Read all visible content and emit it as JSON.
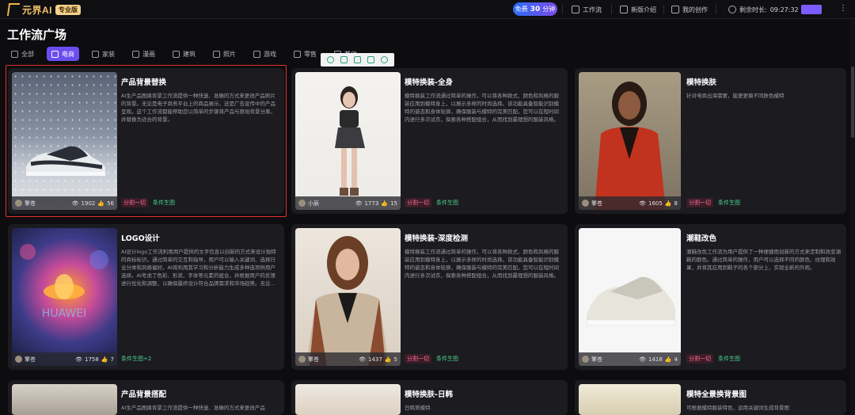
{
  "header": {
    "logo_text": "元界AI",
    "plan_badge": "专业版",
    "free_pill": {
      "prefix": "免费",
      "minutes": "30",
      "suffix": "分钟"
    },
    "nav": [
      {
        "label": "工作流",
        "icon": "workflow-icon"
      },
      {
        "label": "新版介绍",
        "icon": "news-icon"
      },
      {
        "label": "我的创作",
        "icon": "image-icon"
      }
    ],
    "remaining_label": "剩余时长:",
    "remaining_time": "09:27:32",
    "more": "⋮"
  },
  "page_title": "工作流广场",
  "categories": [
    {
      "label": "全部",
      "active": false
    },
    {
      "label": "电商",
      "active": true
    },
    {
      "label": "家装",
      "active": false
    },
    {
      "label": "漫画",
      "active": false
    },
    {
      "label": "建筑",
      "active": false
    },
    {
      "label": "照片",
      "active": false
    },
    {
      "label": "游戏",
      "active": false
    },
    {
      "label": "零售",
      "active": false
    },
    {
      "label": "其他",
      "active": false
    }
  ],
  "cards": [
    {
      "title": "产品背景替换",
      "desc": "AI生产品图换背景工作流提供一种快速、准确的方式来更改产品照片的背景。无论是电子商务平台上的商品展示、还是广告宣传中的产品呈现。这个工作流都能帮助您以简单的步骤将产品与原始背景分离，并替换为适合的背景。",
      "author": "擎苍",
      "views": "1902",
      "likes": "56",
      "tags": [
        "分割一切",
        "条件生图"
      ]
    },
    {
      "title": "模特换装-全身",
      "desc": "模特换装工作流通过简单的操作，可以将各种款式、颜色和风格的服装应用到模特身上，以展示多样的时尚选择。该功能具备智能识别模特的姿态和身体轮廓，确保服装与模特的完美匹配。您可以在短时间内进行多次试衣，探索各种搭配组合，从而找到最理想的服装风格。",
      "author": "小辰",
      "views": "1773",
      "likes": "15",
      "tags": [
        "分割一切",
        "条件生图"
      ]
    },
    {
      "title": "模特换肤",
      "desc": "针对电商出海需要，能更更换不同肤色模特",
      "author": "擎苍",
      "views": "1605",
      "likes": "8",
      "tags": [
        "分割一切",
        "条件生图"
      ]
    },
    {
      "title": "LOGO设计",
      "desc": "AI设计logo工作流利用用户提供的文字信息以创新的方式来设计独特的商标标识。通过简单的交互和指导，用户可以输入关键词、选择行业分类和风格偏好。AI将利用其学习和分析能力生成多种选项供用户选择。AI考虑了色彩、形状、字体等元素的组合，并根据用户的反馈进行优化和调整，以确保最终设计符合品牌需求和市场趋势。无论...",
      "author": "擎苍",
      "views": "1758",
      "likes": "7",
      "tags": [
        "条件生图+2"
      ]
    },
    {
      "title": "模特换装-深度检测",
      "desc": "模特换装工作流通过简单的操作，可以将各种款式、颜色和风格的服装应用到模特身上，以展示多样的时尚选择。该功能具备智能识别模特的姿态和身体轮廓，确保服装与模特的完美匹配。您可以在短时间内进行多次试衣，探索各种搭配组合，从而找到最理想的服装风格。",
      "author": "擎苍",
      "views": "1437",
      "likes": "5",
      "tags": [
        "分割一切",
        "条件生图"
      ]
    },
    {
      "title": "潮鞋改色",
      "desc": "潮鞋改色工作流为用户提供了一种便捷而创新的方式来定制和改变潮鞋的颜色。通过简单的操作，用户可以选择不同的颜色、纹理和效果，并将其应用到鞋子的各个部分上，实现全新的外观。",
      "author": "擎苍",
      "views": "1418",
      "likes": "4",
      "tags": [
        "分割一切",
        "条件生图"
      ]
    },
    {
      "title": "产品背景搭配",
      "desc": "AI生产品图换背景工作流提供一种快速、准确的方式来更改产品",
      "author": "",
      "views": "",
      "likes": "",
      "tags": []
    },
    {
      "title": "模特换肤-日韩",
      "desc": "日韩美模特",
      "author": "",
      "views": "",
      "likes": "",
      "tags": []
    },
    {
      "title": "模特全景换背景图",
      "desc": "可根据模特服装特色，运用关键词生成背景图",
      "author": "",
      "views": "",
      "likes": "",
      "tags": []
    }
  ],
  "colors": {
    "accent": "#6b4ef0",
    "tag_pink": "#ff6d95",
    "tag_green": "#4fd28c",
    "selection": "#e0312d"
  }
}
